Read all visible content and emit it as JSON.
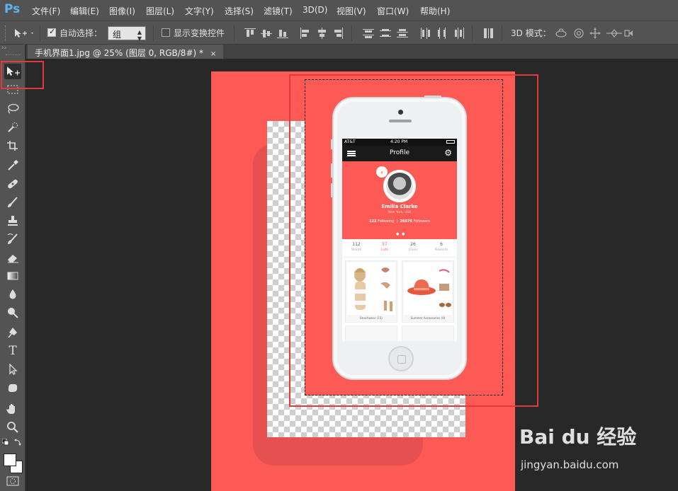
{
  "app": {
    "logo": "Ps"
  },
  "menu": [
    "文件(F)",
    "编辑(E)",
    "图像(I)",
    "图层(L)",
    "文字(Y)",
    "选择(S)",
    "滤镜(T)",
    "3D(D)",
    "视图(V)",
    "窗口(W)",
    "帮助(H)"
  ],
  "options": {
    "auto_select_label": "自动选择：",
    "auto_select_value": "组",
    "show_transform_label": "显示变换控件",
    "mode3d_label": "3D 模式："
  },
  "document": {
    "tab_title": "手机界面1.jpg @ 25% (图层 0, RGB/8#) *",
    "close_glyph": "×"
  },
  "toolbox": {
    "collapse_glyph": "››"
  },
  "phone_screen": {
    "carrier": "AT&T",
    "time": "4:20 PM",
    "nav_title": "Profile",
    "user_name": "Emilia Clarke",
    "location": "New York, USA",
    "following_count": "122",
    "following_label": "Following",
    "followers_count": "26676",
    "followers_label": "Followers",
    "tabs": [
      {
        "count": "112",
        "label": "Wants"
      },
      {
        "count": "57",
        "label": "Lists"
      },
      {
        "count": "26",
        "label": "Looks"
      },
      {
        "count": "6",
        "label": "Rewards"
      }
    ],
    "cards": [
      {
        "name": "Beachwear",
        "count": "(15)"
      },
      {
        "name": "Summer Accessories",
        "count": "(9)"
      }
    ]
  },
  "watermark": {
    "brand": "Bai du 经验",
    "domain": "jingyan.baidu.com"
  },
  "colors": {
    "accent_red": "#fd5a55",
    "highlight": "#e03a3a",
    "ui_gray": "#535353",
    "canvas_bg": "#282828"
  }
}
